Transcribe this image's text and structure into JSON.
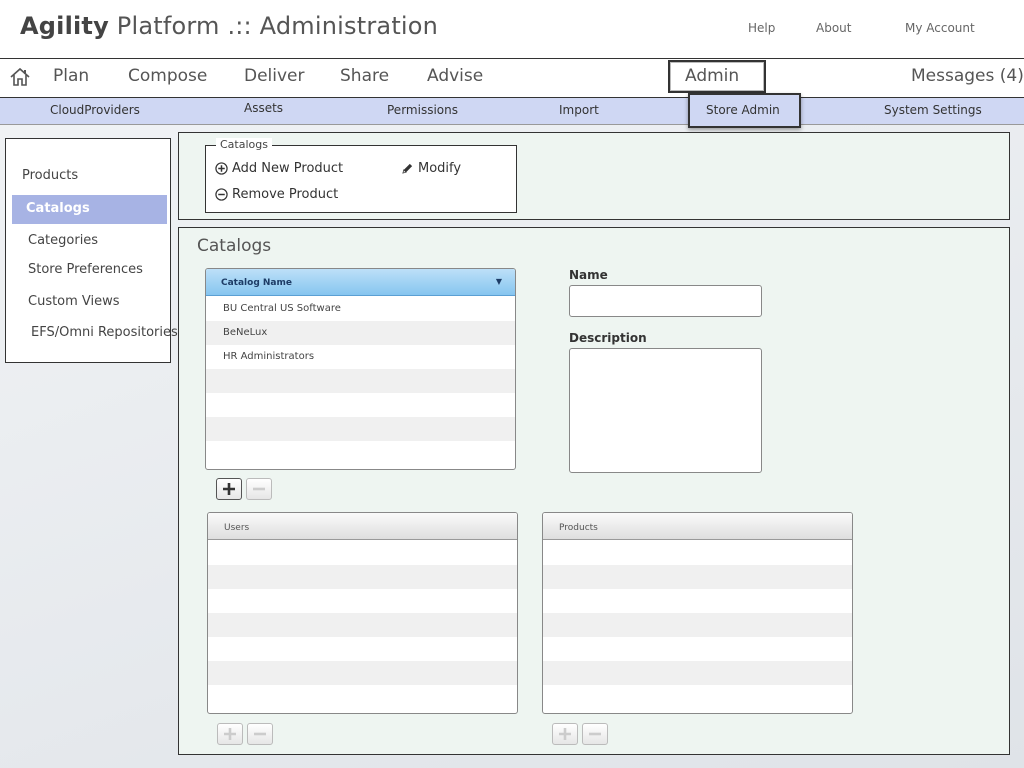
{
  "header": {
    "brand": "Agility",
    "title_rest": "Platform .:: Administration",
    "links": [
      "Help",
      "About",
      "My Account"
    ]
  },
  "main_nav": {
    "items": [
      "Plan",
      "Compose",
      "Deliver",
      "Share",
      "Advise",
      "Admin"
    ],
    "messages": "Messages (4)",
    "home_icon": "home-icon"
  },
  "sub_nav": {
    "items": [
      "CloudProviders",
      "Assets",
      "Permissions",
      "Import",
      "Store Admin",
      "System Settings"
    ],
    "active": "Store Admin"
  },
  "sidebar": {
    "heading": "Products",
    "items": [
      "Catalogs",
      "Categories",
      "Store Preferences",
      "Custom Views",
      "EFS/Omni Repositories"
    ],
    "active": "Catalogs",
    "active_color": "#a7b3e4"
  },
  "toolbar": {
    "legend": "Catalogs",
    "add": "Add New Product",
    "modify": "Modify",
    "remove": "Remove Product"
  },
  "panel": {
    "title": "Catalogs",
    "catalog_grid": {
      "column": "Catalog Name",
      "rows": [
        "BU Central US Software",
        "BeNeLux",
        "HR Administrators"
      ]
    },
    "name_label": "Name",
    "name_value": "",
    "description_label": "Description",
    "description_value": "",
    "users_grid": {
      "column": "Users"
    },
    "products_grid": {
      "column": "Products"
    }
  },
  "colors": {
    "subnav_bg": "#cfd7f3",
    "panel_bg": "#eef5f1",
    "grid_header_blue": "#86c5ef"
  }
}
